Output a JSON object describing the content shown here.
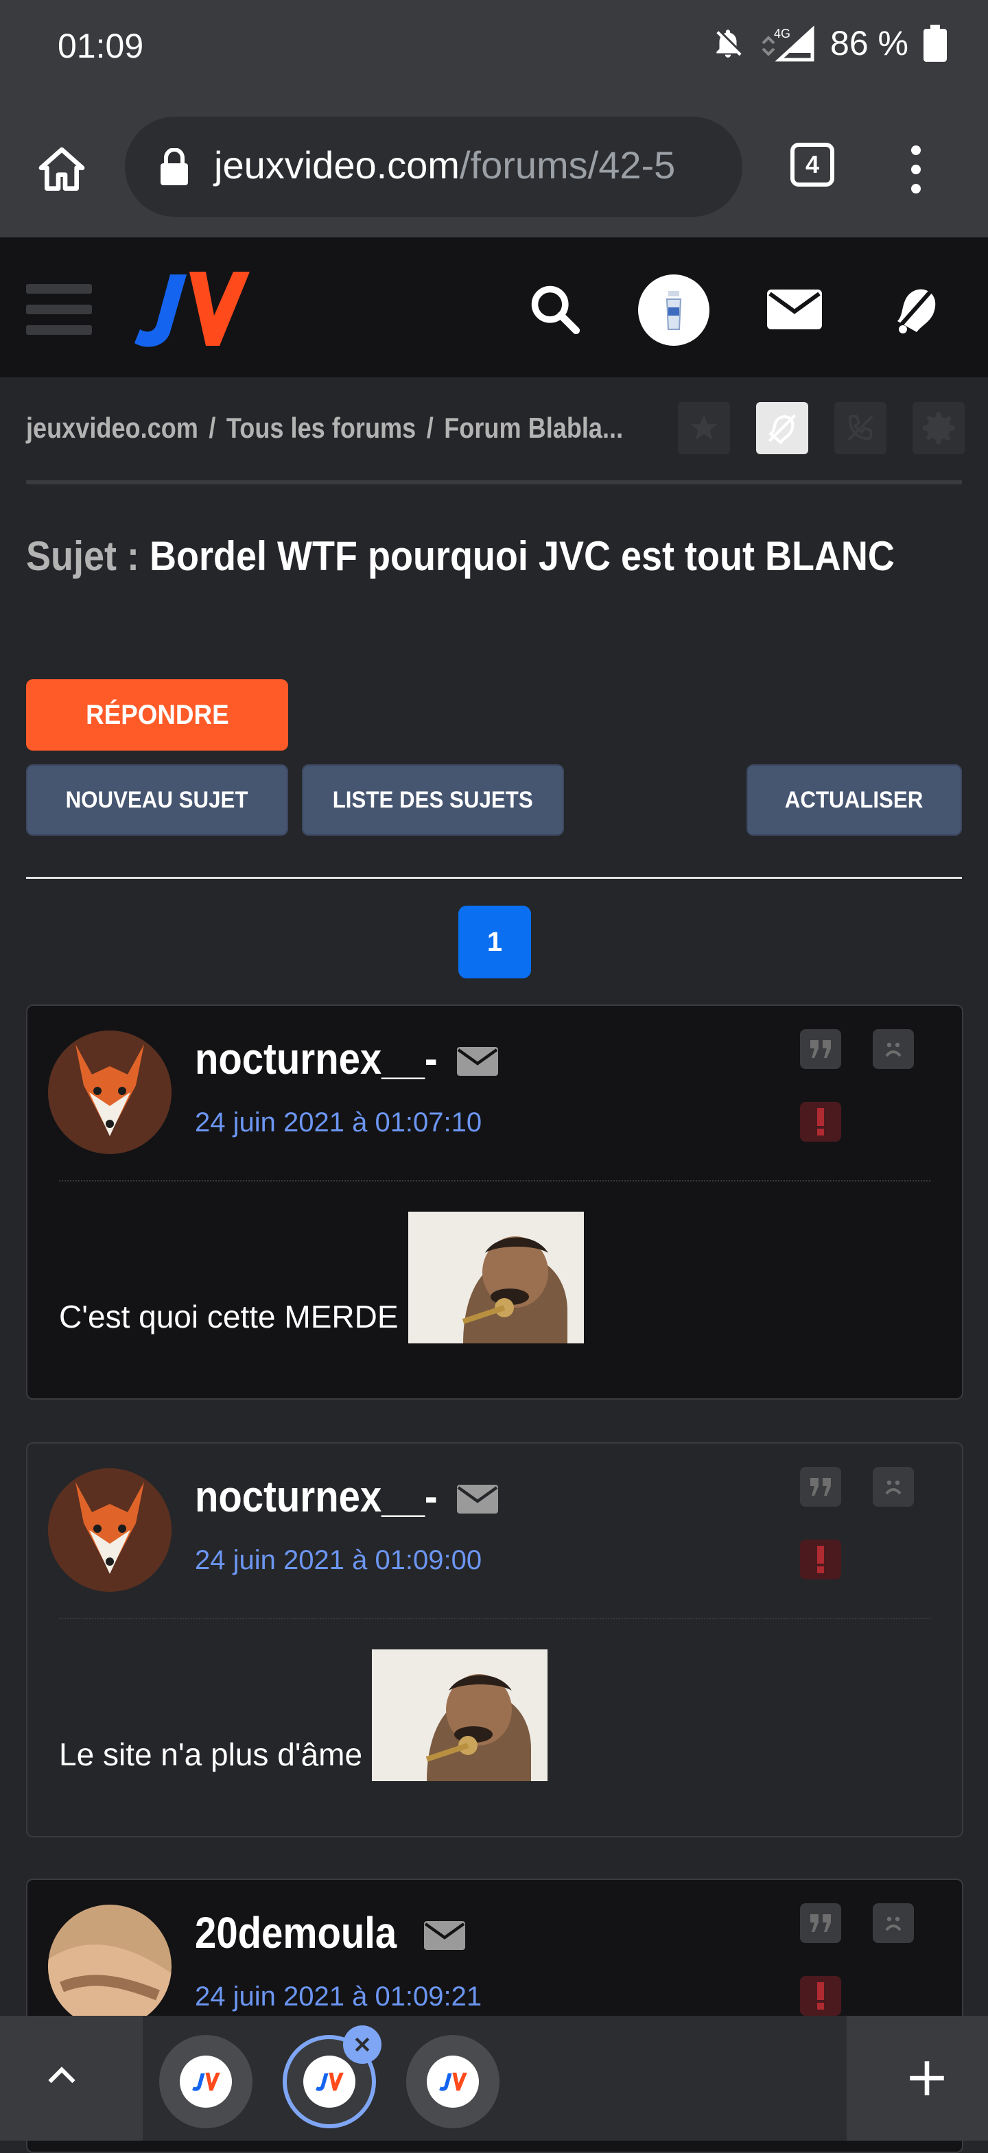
{
  "status_bar": {
    "time": "01:09",
    "network": "4G",
    "battery": "86 %"
  },
  "browser": {
    "url_main": "jeuxvideo.com",
    "url_rest": "/forums/42-5",
    "tab_count": "4"
  },
  "breadcrumb": {
    "items": [
      "jeuxvideo.com",
      "Tous les forums",
      "Forum Blabla..."
    ]
  },
  "topic": {
    "label": "Sujet :",
    "title": "Bordel WTF pourquoi JVC est tout BLANC"
  },
  "buttons": {
    "reply": "RÉPONDRE",
    "new_topic": "NOUVEAU SUJET",
    "topic_list": "LISTE DES SUJETS",
    "refresh": "ACTUALISER"
  },
  "pagination": {
    "current": "1"
  },
  "posts": [
    {
      "author": "nocturnex__-",
      "date": "24 juin 2021 à 01:07:10",
      "text": "C'est quoi cette MERDE",
      "avatar": "fox"
    },
    {
      "author": "nocturnex__-",
      "date": "24 juin 2021 à 01:09:00",
      "text": "Le site n'a plus d'âme",
      "avatar": "fox"
    },
    {
      "author": "20demoula",
      "date": "24 juin 2021 à 01:09:21",
      "text": "",
      "avatar": "blur"
    }
  ],
  "colors": {
    "accent_orange": "#ff5b28",
    "page_blue": "#0a6ff0",
    "date_blue": "#6c96f2",
    "button_grey": "#465570"
  }
}
